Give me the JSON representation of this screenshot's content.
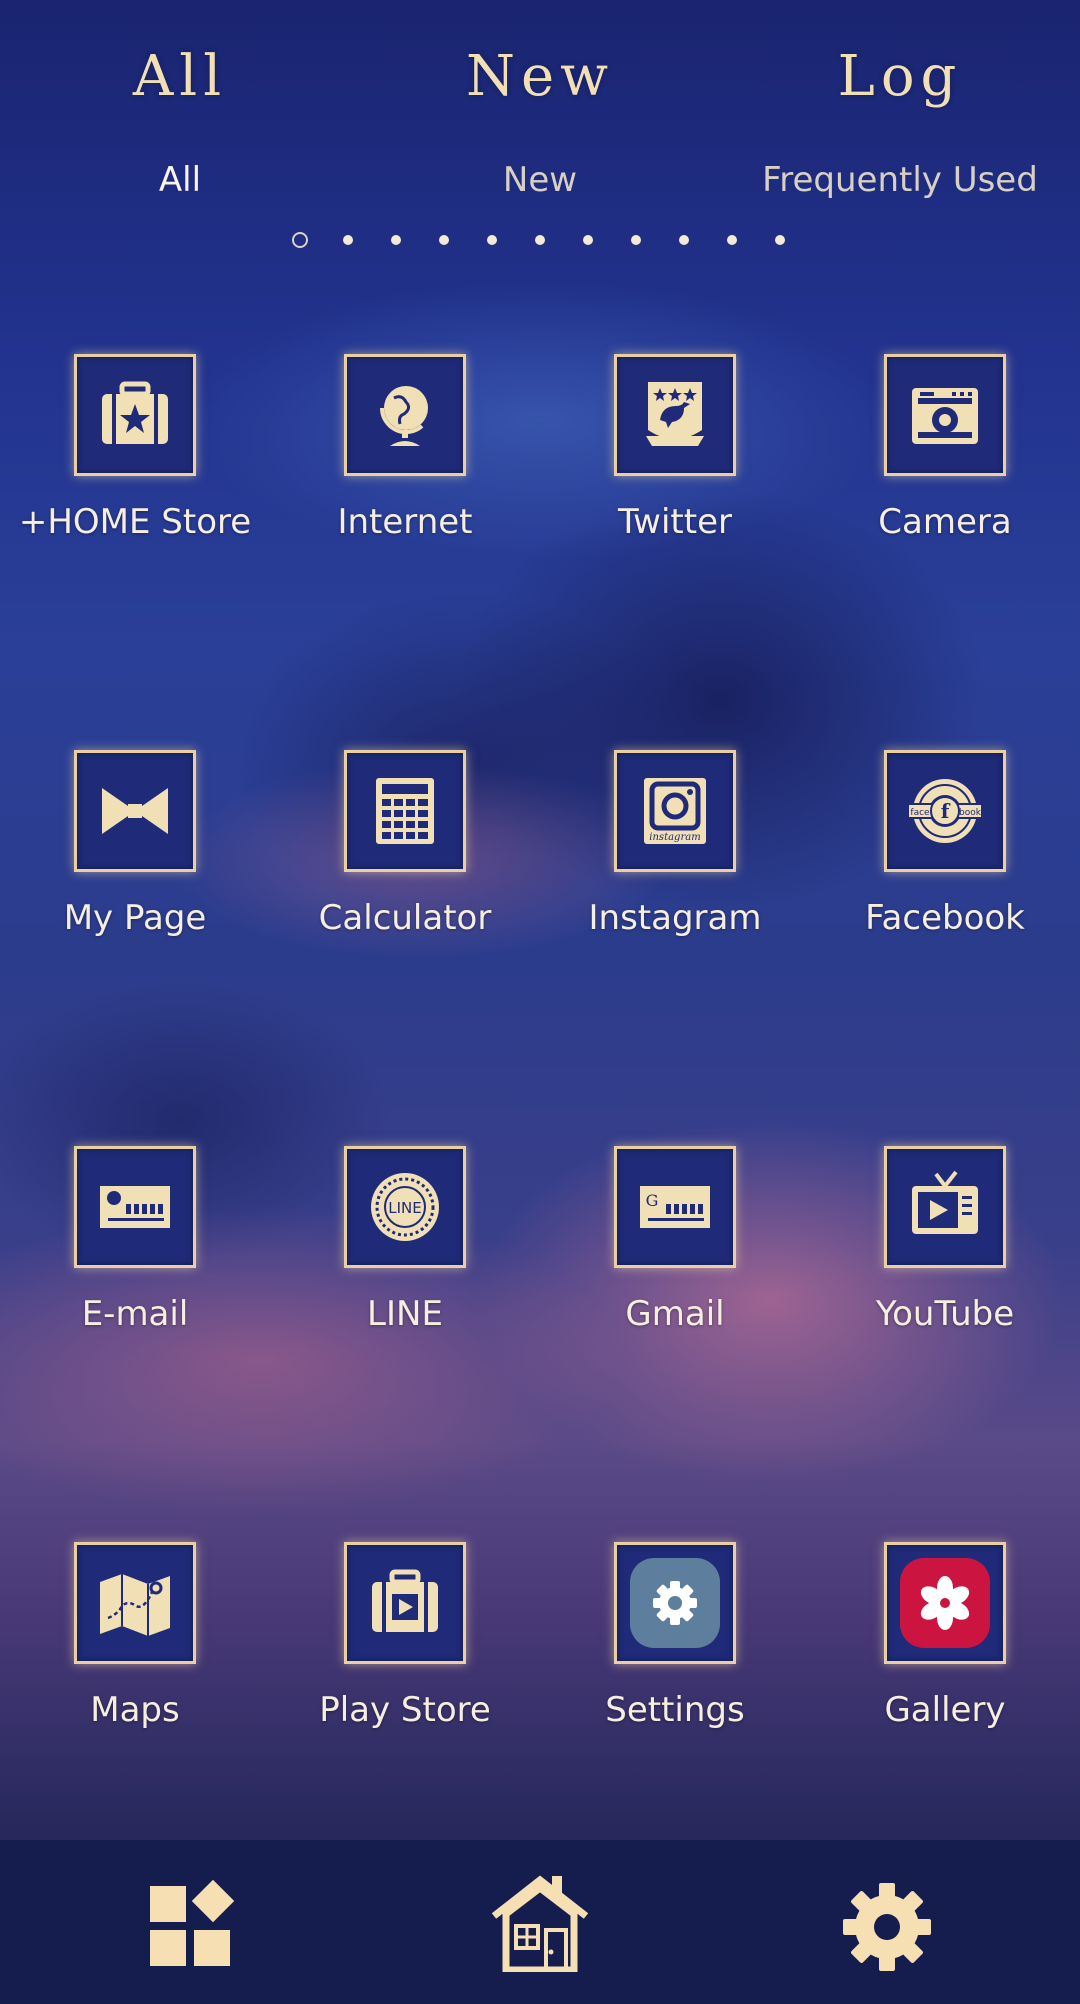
{
  "header": {
    "script_tabs": [
      "All",
      "New",
      "Log"
    ],
    "tabs": [
      {
        "label": "All",
        "active": true
      },
      {
        "label": "New",
        "active": false
      },
      {
        "label": "Frequently Used",
        "active": false
      }
    ],
    "pages": {
      "count": 11,
      "current": 1
    }
  },
  "apps": [
    {
      "label": "+HOME Store",
      "icon": "suitcase-star-icon"
    },
    {
      "label": "Internet",
      "icon": "globe-icon"
    },
    {
      "label": "Twitter",
      "icon": "bird-crest-icon"
    },
    {
      "label": "Camera",
      "icon": "camera-icon"
    },
    {
      "label": "My Page",
      "icon": "bow-tie-icon"
    },
    {
      "label": "Calculator",
      "icon": "calculator-icon"
    },
    {
      "label": "Instagram",
      "icon": "instagram-icon",
      "icon_text": "instagram"
    },
    {
      "label": "Facebook",
      "icon": "facebook-badge-icon",
      "icon_text": [
        "face",
        "f",
        "book"
      ]
    },
    {
      "label": "E-mail",
      "icon": "envelope-stamp-icon"
    },
    {
      "label": "LINE",
      "icon": "line-badge-icon",
      "icon_text": "LINE"
    },
    {
      "label": "Gmail",
      "icon": "gmail-envelope-icon",
      "icon_text": "G"
    },
    {
      "label": "YouTube",
      "icon": "tv-icon"
    },
    {
      "label": "Maps",
      "icon": "map-icon"
    },
    {
      "label": "Play Store",
      "icon": "suitcase-play-icon"
    },
    {
      "label": "Settings",
      "icon": "settings-gear-icon"
    },
    {
      "label": "Gallery",
      "icon": "flower-icon"
    }
  ],
  "dock": [
    {
      "icon": "widgets-icon"
    },
    {
      "icon": "home-icon"
    },
    {
      "icon": "gear-icon"
    }
  ],
  "colors": {
    "cream": "#f1dfb6",
    "tile_bg": "#1f2a78",
    "settings_bg": "#5e7e9e",
    "gallery_bg": "#cc1440"
  }
}
